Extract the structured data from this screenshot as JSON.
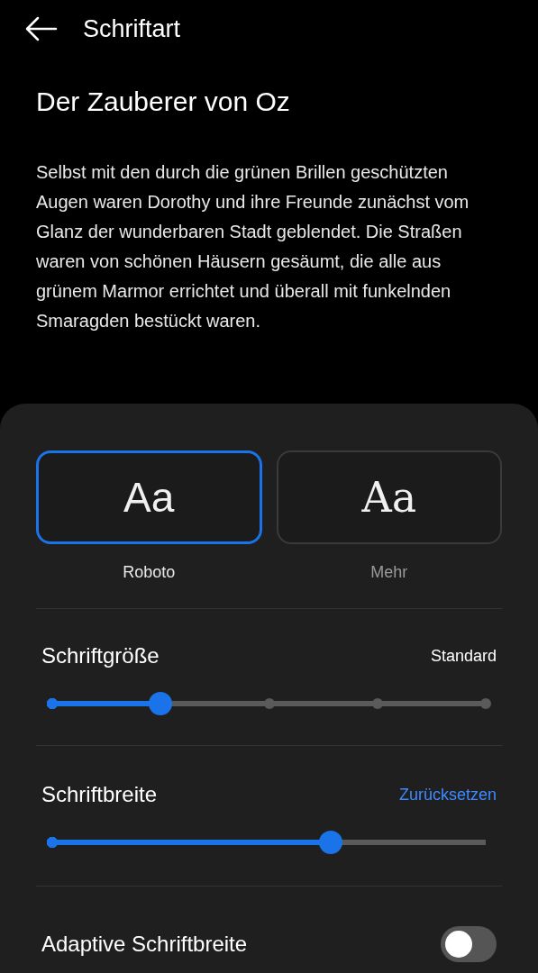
{
  "header": {
    "title": "Schriftart"
  },
  "preview": {
    "title": "Der Zauberer von Oz",
    "text": "Selbst mit den durch die grünen Brillen geschützten Augen waren Dorothy und ihre Freunde zunächst vom Glanz der wunderbaren Stadt geblendet. Die Straßen waren von schönen Häusern gesäumt, die alle aus grünem Marmor errichtet und überall mit funkelnden Smaragden bestückt waren."
  },
  "fonts": [
    {
      "kind": "sans",
      "sample": "Aa",
      "label": "Roboto",
      "selected": true
    },
    {
      "kind": "serif",
      "sample": "Aa",
      "label": "Mehr",
      "selected": false
    }
  ],
  "font_size": {
    "label": "Schriftgröße",
    "value": "Standard",
    "level": 0.25
  },
  "font_width": {
    "label": "Schriftbreite",
    "action": "Zurücksetzen",
    "level": 0.643
  },
  "adaptive_width": {
    "label": "Adaptive Schriftbreite",
    "on": false
  }
}
